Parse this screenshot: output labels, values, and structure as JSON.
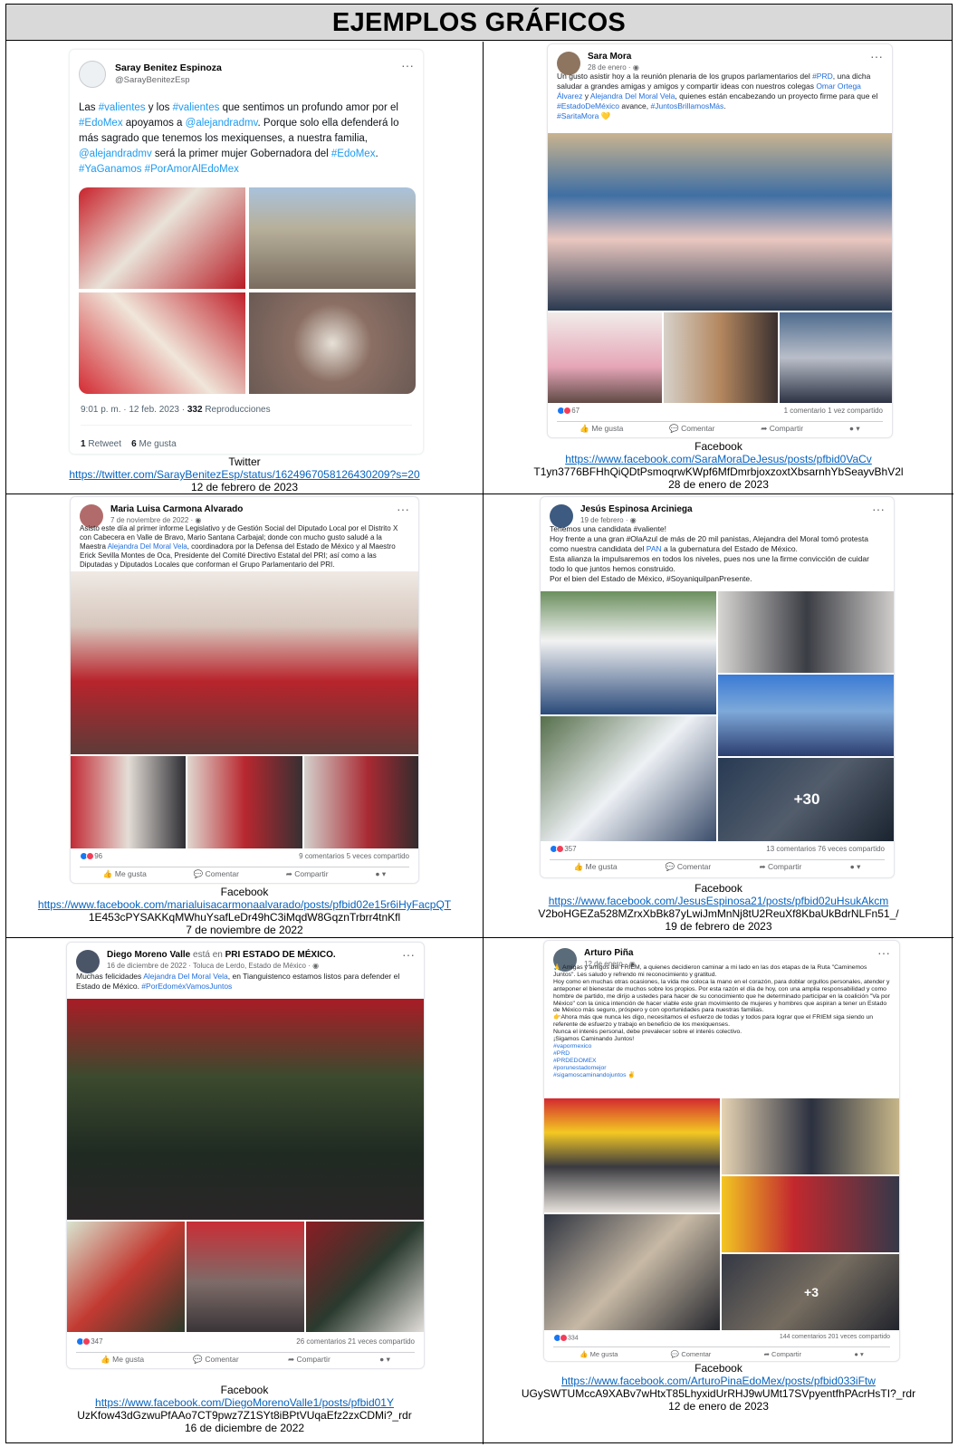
{
  "doc": {
    "title": "EJEMPLOS GRÁFICOS"
  },
  "posts": [
    {
      "platform": "Twitter",
      "author": "Saray Benitez Espinoza",
      "handle": "@SarayBenitezEsp",
      "text_parts": [
        "Las ",
        "#valientes",
        " y los ",
        "#valientes",
        " que sentimos un profundo amor por el ",
        "#EdoMex",
        " apoyamos a ",
        "@alejandradmv",
        ". Porque solo ella defenderá lo más sagrado que tenemos los mexiquenses, a nuestra familia, ",
        "@alejandradmv",
        " será la primer mujer Gobernadora del ",
        "#EdoMex",
        ". ",
        "#YaGanamos",
        " ",
        "#PorAmorAlEdoMex"
      ],
      "time_prefix": "9:01 p. m. · 12 feb. 2023 · ",
      "views": "332",
      "views_label": " Reproducciones",
      "retweets": "1",
      "retweets_label": " Retweet",
      "likes": "6",
      "likes_label": " Me gusta",
      "caption_platform": "Twitter",
      "caption_url_lines": [
        "https://twitter.com/SarayBenitezEsp/status/1624967058126430209?s=20"
      ],
      "caption_date": "12 de febrero de 2023"
    },
    {
      "platform": "Facebook",
      "author": "Sara Mora",
      "meta": "28 de enero · ◉",
      "text_parts": [
        "Un gusto asistir hoy a la reunión plenaria de los grupos parlamentarios del ",
        "#PRD",
        ", una dicha saludar a grandes amigas y amigos y compartir ideas con nuestros colegas ",
        "Omar Ortega Álvarez",
        " y ",
        "Alejandra Del Moral Vela",
        ", quienes están encabezando un proyecto firme para que el ",
        "#EstadoDeMéxico",
        " avance, ",
        "#JuntosBrillamosMás",
        ".",
        "\n",
        "#SaritaMora",
        " 💛"
      ],
      "reactions": "67",
      "counts": "1 comentario   1 vez compartido",
      "like_label": "Me gusta",
      "comment_label": "Comentar",
      "share_label": "Compartir",
      "caption_platform": "Facebook",
      "caption_url_lines": [
        "https://www.facebook.com/SaraMoraDeJesus/posts/pfbid0VaCv"
      ],
      "caption_extra": "T1yn3776BFHhQiQDtPsmoqrwKWpf6MfDmrbjoxzoxtXbsarnhYbSeayvBhV2l",
      "caption_date": "28 de enero de 2023"
    },
    {
      "platform": "Facebook",
      "author": "Maria Luisa Carmona Alvarado",
      "meta": "7 de noviembre de 2022 · ◉",
      "text_parts": [
        "Asisto este día al primer informe Legislativo y de Gestión Social del Diputado Local por el Distrito X con Cabecera en Valle de Bravo, Mario Santana Carbajal; donde con mucho gusto saludé a la Maestra ",
        "Alejandra Del Moral Vela",
        ", coordinadora por la Defensa del Estado de México y al Maestro Erick Sevilla Montes de Oca, Presidente del Comité Directivo Estatal del PRI; así como a las Diputadas y Diputados Locales que conforman el Grupo Parlamentario del PRI."
      ],
      "reactions": "96",
      "counts": "9 comentarios   5 veces compartido",
      "like_label": "Me gusta",
      "comment_label": "Comentar",
      "share_label": "Compartir",
      "caption_platform": "Facebook",
      "caption_url_lines": [
        "https://www.facebook.com/marialuisacarmonaalvarado/posts/pfbid02e15r6iHyFacpQT"
      ],
      "caption_extra": "1E453cPYSAKKqMWhuYsafLeDr49hC3iMqdW8GqznTrbrr4tnKfl",
      "caption_date": "7 de noviembre de 2022"
    },
    {
      "platform": "Facebook",
      "author": "Jesús Espinosa Arciniega",
      "meta": "19 de febrero · ◉",
      "text_parts": [
        "Tenemos una candidata #valiente!",
        "\n",
        "Hoy frente a una gran #OlaAzul de más de 20 mil panistas, Alejandra del Moral tomó protesta como nuestra candidata del ",
        "PAN",
        " a la gubernatura del Estado de México.",
        "\n",
        "Esta alianza la impulsaremos en todos los niveles, pues nos une la firme convicción de cuidar todo lo que juntos hemos construido.",
        "\n",
        "Por el bien del Estado de México, #SoyaniquilpanPresente."
      ],
      "reactions": "357",
      "counts": "13 comentarios   76 veces compartido",
      "photo_overlay": "+30",
      "like_label": "Me gusta",
      "comment_label": "Comentar",
      "share_label": "Compartir",
      "caption_platform": "Facebook",
      "caption_url_lines": [
        "https://www.facebook.com/JesusEspinosa21/posts/pfbid02uHsukAkcm"
      ],
      "caption_extra": "V2boHGEZa528MZrxXbBk87yLwiJmMnNj8tU2ReuXf8KbaUkBdrNLFn51_/",
      "caption_date": "19 de febrero de 2023"
    },
    {
      "platform": "Facebook",
      "author": "Diego Moreno Valle",
      "author_suffix": " está en ",
      "author_place": "PRI ESTADO DE MÉXICO.",
      "meta": "16 de diciembre de 2022 · Toluca de Lerdo, Estado de México · ◉",
      "text_parts": [
        "Muchas felicidades ",
        "Alejandra Del Moral Vela",
        ", en Tianguistenco estamos listos para defender el Estado de México. ",
        "#PorEdoméxVamosJuntos"
      ],
      "reactions": "347",
      "counts": "26 comentarios   21 veces compartido",
      "like_label": "Me gusta",
      "comment_label": "Comentar",
      "share_label": "Compartir",
      "caption_platform": "Facebook",
      "caption_url_lines": [
        "https://www.facebook.com/DiegoMorenoValle1/posts/pfbid01Y"
      ],
      "caption_extra": "UzKfow43dGzwuPfAAo7CT9pwz7Z1SYt8iBPtVUqaEfz2zxCDMi?_rdr",
      "caption_date": "16 de diciembre de 2022"
    },
    {
      "platform": "Facebook",
      "author": "Arturo Piña",
      "meta": "12 de enero · ◉",
      "text_parts": [
        "🙏 Amigas y amigos del FRIEM, a quienes decidieron caminar a mi lado en las dos etapas de la Ruta \"Caminemos Juntos\". Les saludo y refrendo mi reconocimiento y gratitud.",
        "\n",
        "Hoy como en muchas otras ocasiones, la vida me coloca la mano en el corazón, para doblar orgullos personales, atender y anteponer el bienestar de muchos sobre los propios. Por esta razón el día de hoy, con una amplia responsabilidad y como hombre de partido, me dirijo a ustedes para hacer de su conocimiento que he determinado participar en la coalición \"Va por México\" con la única intención de hacer viable este gran movimiento de mujeres y hombres que aspiran a tener un Estado de México más seguro, próspero y con oportunidades para nuestras familias.",
        "\n",
        "👉Ahora más que nunca les digo, necesitamos el esfuerzo de todas y todos para lograr que el FRIEM siga siendo un referente de esfuerzo y trabajo en beneficio de los mexiquenses.",
        "\n",
        "Nunca el interés personal, debe prevalecer sobre el interés colectivo.",
        "\n",
        "¡Sigamos Caminando Juntos!",
        "\n",
        "#vapormexico",
        "\n",
        "#PRD",
        "\n",
        "#PRDEDOMEX",
        "\n",
        "#porunestadomejor",
        "\n",
        "#sigamoscaminandojuntos",
        " ✌"
      ],
      "reactions": "334",
      "counts": "144 comentarios   201 veces compartido",
      "photo_overlay": "+3",
      "like_label": "Me gusta",
      "comment_label": "Comentar",
      "share_label": "Compartir",
      "caption_platform": "Facebook",
      "caption_url_lines": [
        "https://www.facebook.com/ArturoPinaEdoMex/posts/pfbid033iFtw"
      ],
      "caption_extra": "UGySWTUMccA9XABv7wHtxT85LhyxidUrRHJ9wUMt17SVpyentfhPAcrHsTI?_rdr",
      "caption_date": "12 de enero de 2023"
    }
  ],
  "colors": {
    "title_bg": "#d9d9d9",
    "link": "#0563c1",
    "twitter_link": "#1d9bf0",
    "facebook_link": "#216fdb",
    "like_blue": "#1877f2",
    "love_red": "#f33e58"
  },
  "icons": {
    "like": "thumb-up-icon",
    "comment": "speech-bubble-icon",
    "share": "share-arrow-icon",
    "more": "more-dots-icon"
  }
}
